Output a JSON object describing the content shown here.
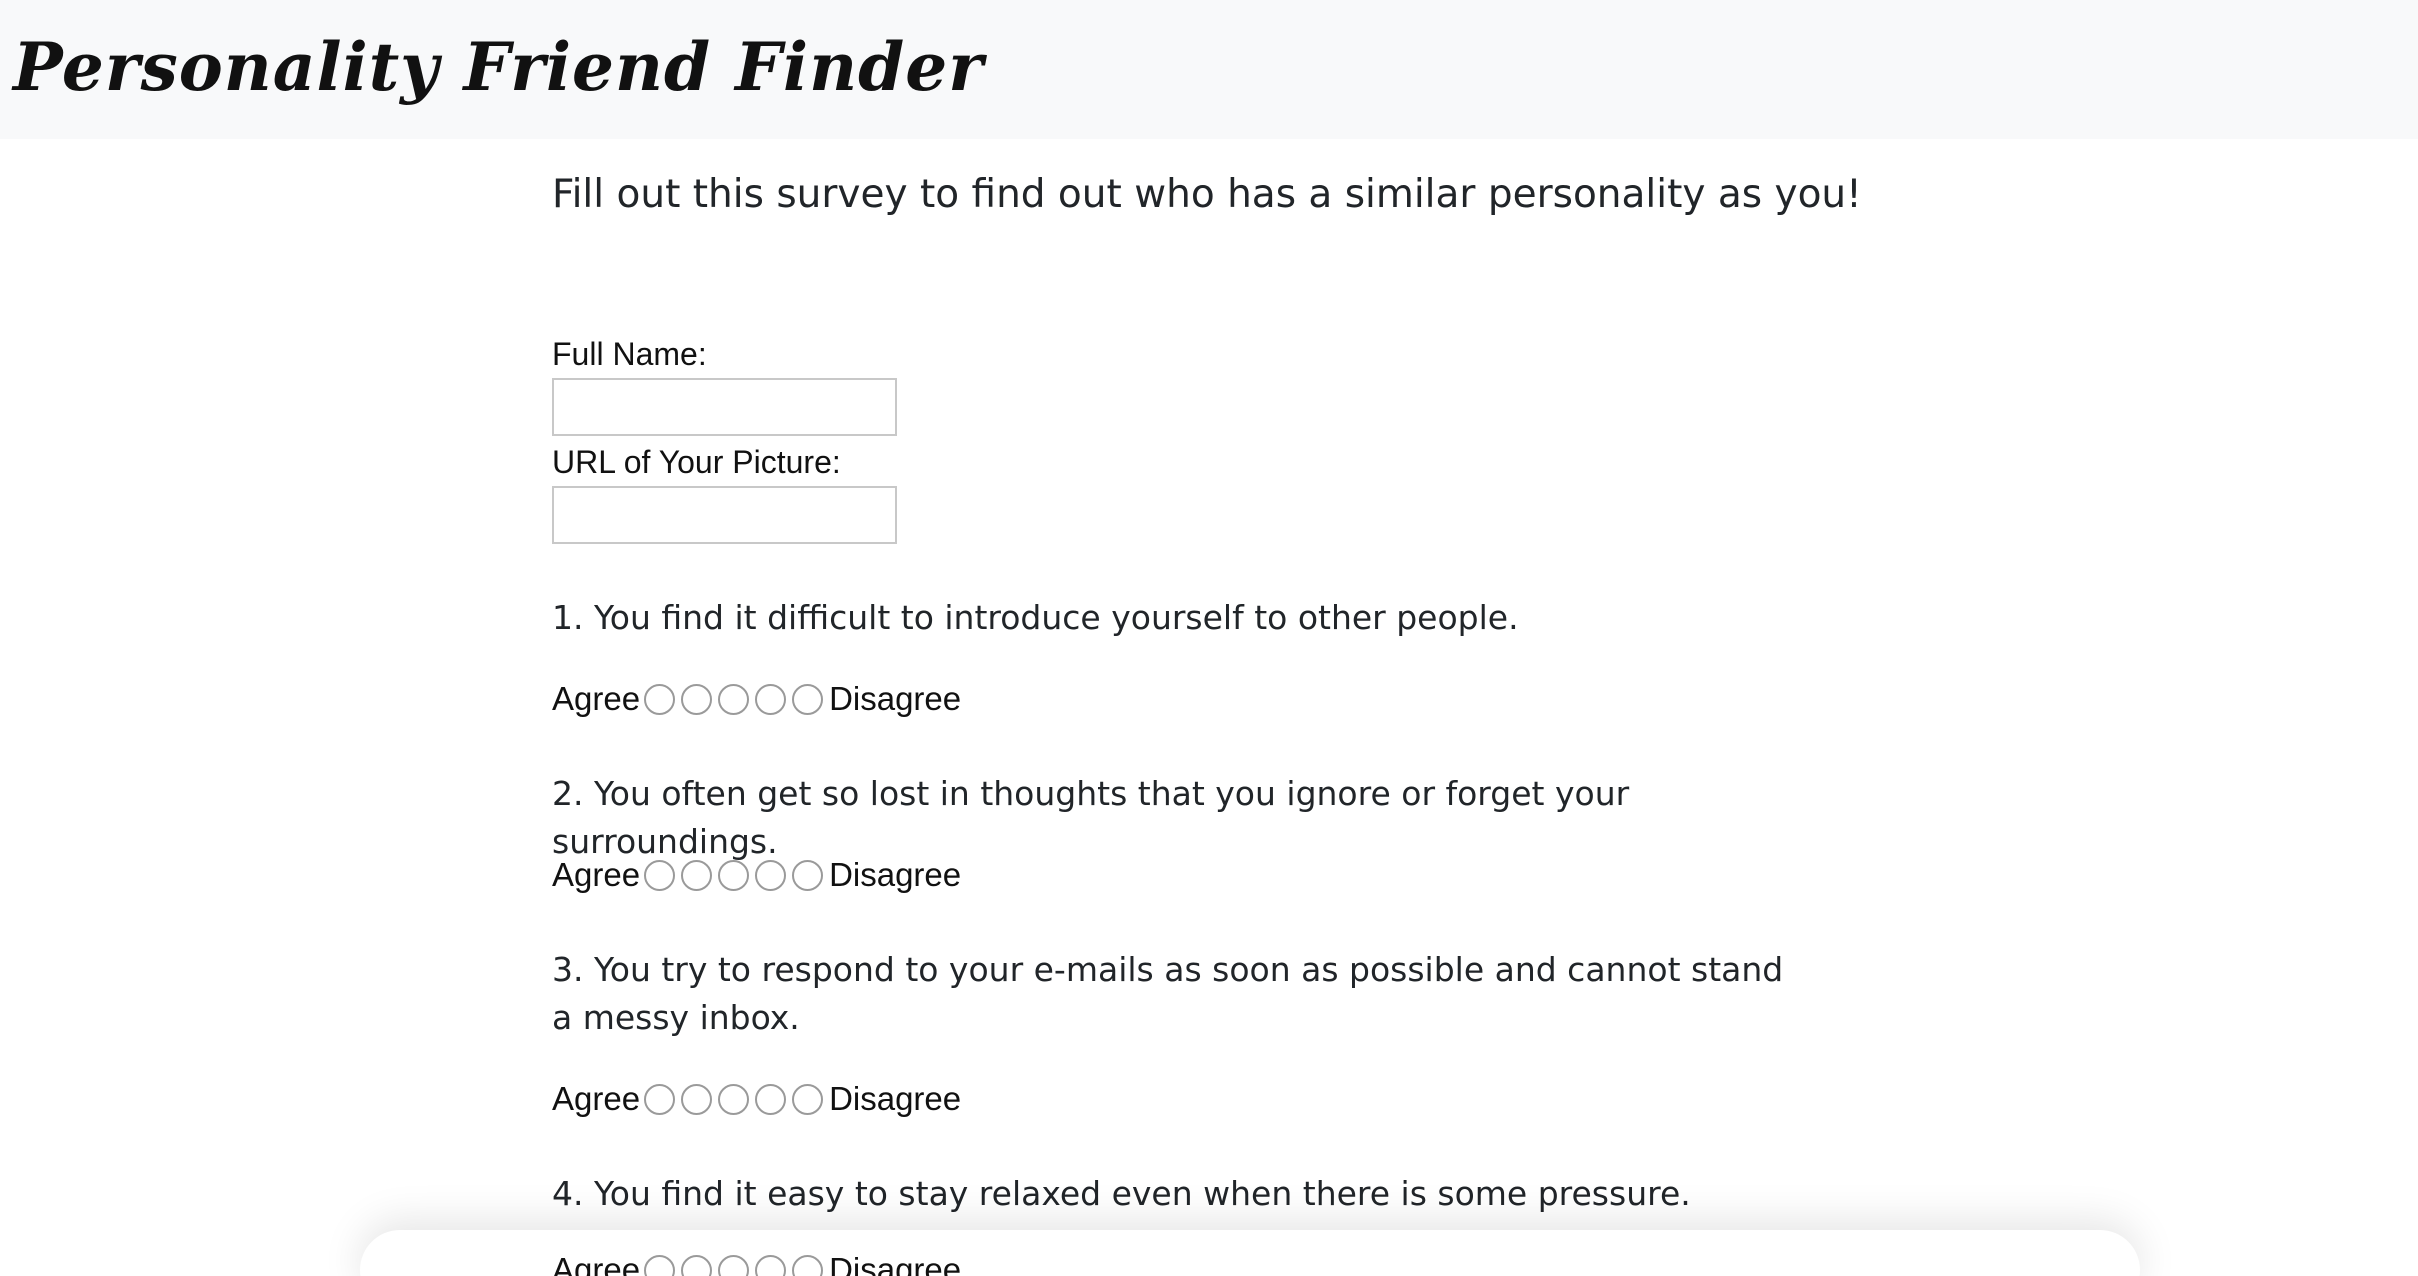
{
  "navbar": {
    "brand": "Personality Friend Finder"
  },
  "intro": {
    "lead": "Fill out this survey to find out who has a similar personality as you!"
  },
  "form": {
    "name_label": "Full Name:",
    "name_value": "",
    "photo_label": "URL of Your Picture:",
    "photo_value": ""
  },
  "scale": {
    "low_label": "Agree",
    "high_label": "Disagree",
    "options": 5
  },
  "questions": [
    {
      "text": "1. You find it difficult to introduce yourself to other people."
    },
    {
      "text": "2. You often get so lost in thoughts that you ignore or forget your surroundings."
    },
    {
      "text": "3. You try to respond to your e-mails as soon as possible and cannot stand a messy inbox."
    },
    {
      "text": "4. You find it easy to stay relaxed even when there is some pressure."
    }
  ]
}
